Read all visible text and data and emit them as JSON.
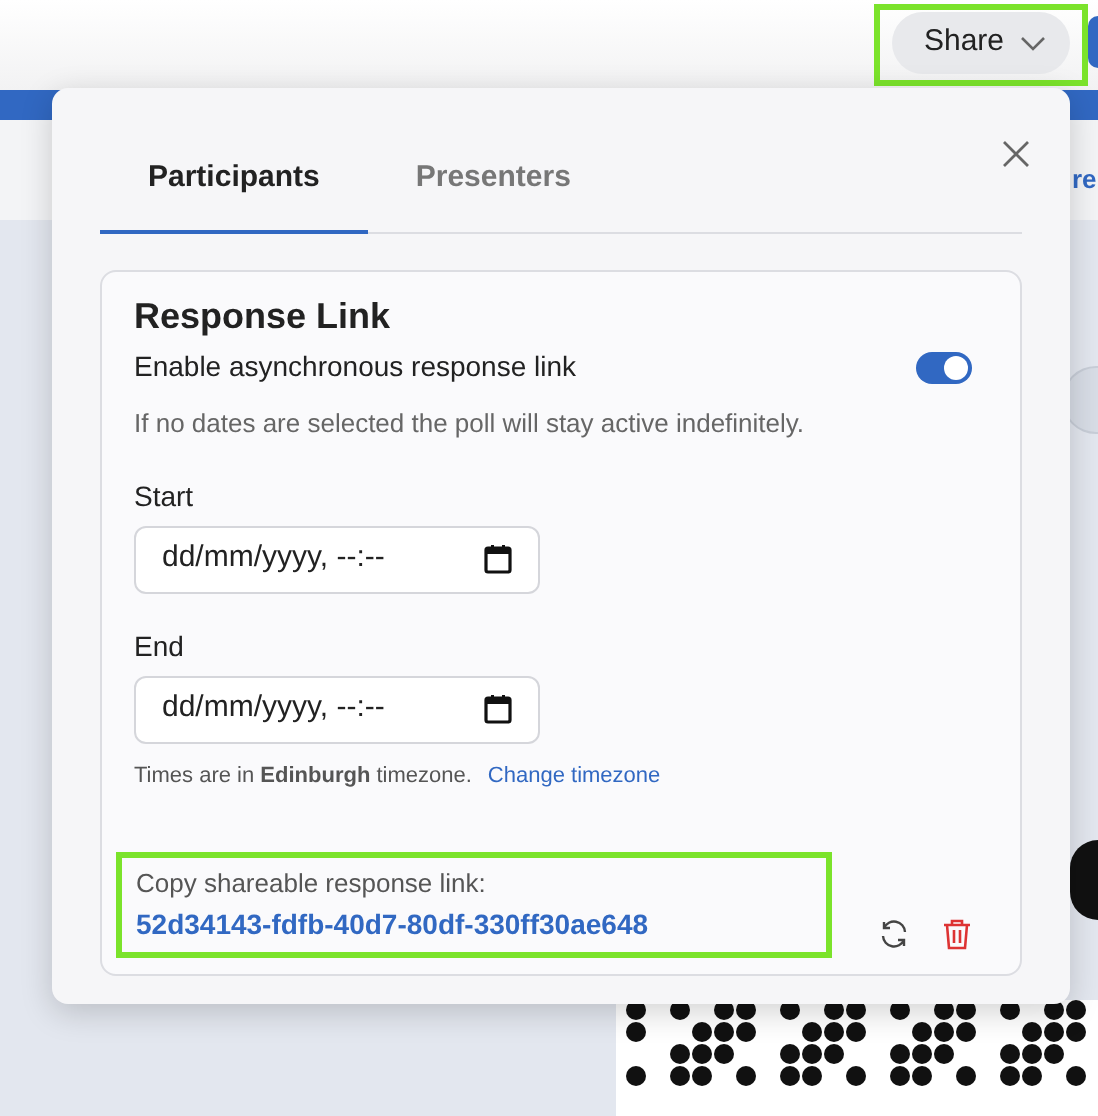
{
  "header": {
    "share_button": "Share"
  },
  "background": {
    "partial_text": "re"
  },
  "dialog": {
    "tabs": [
      {
        "label": "Participants",
        "selected": true
      },
      {
        "label": "Presenters",
        "selected": false
      }
    ],
    "section": {
      "title": "Response Link",
      "toggle": {
        "label": "Enable asynchronous response link",
        "on": true
      },
      "hint": "If no dates are selected the poll will stay active indefinitely.",
      "fields": [
        {
          "label": "Start",
          "placeholder": "dd/mm/yyyy, --:--"
        },
        {
          "label": "End",
          "placeholder": "dd/mm/yyyy, --:--"
        }
      ],
      "timezone_note": "Times are in **Edinburgh** timezone.",
      "change_timezone": "Change timezone",
      "link_label": "Copy shareable response link:",
      "link": "52d34143-fdfb-40d7-80df-330ff30ae648"
    }
  }
}
